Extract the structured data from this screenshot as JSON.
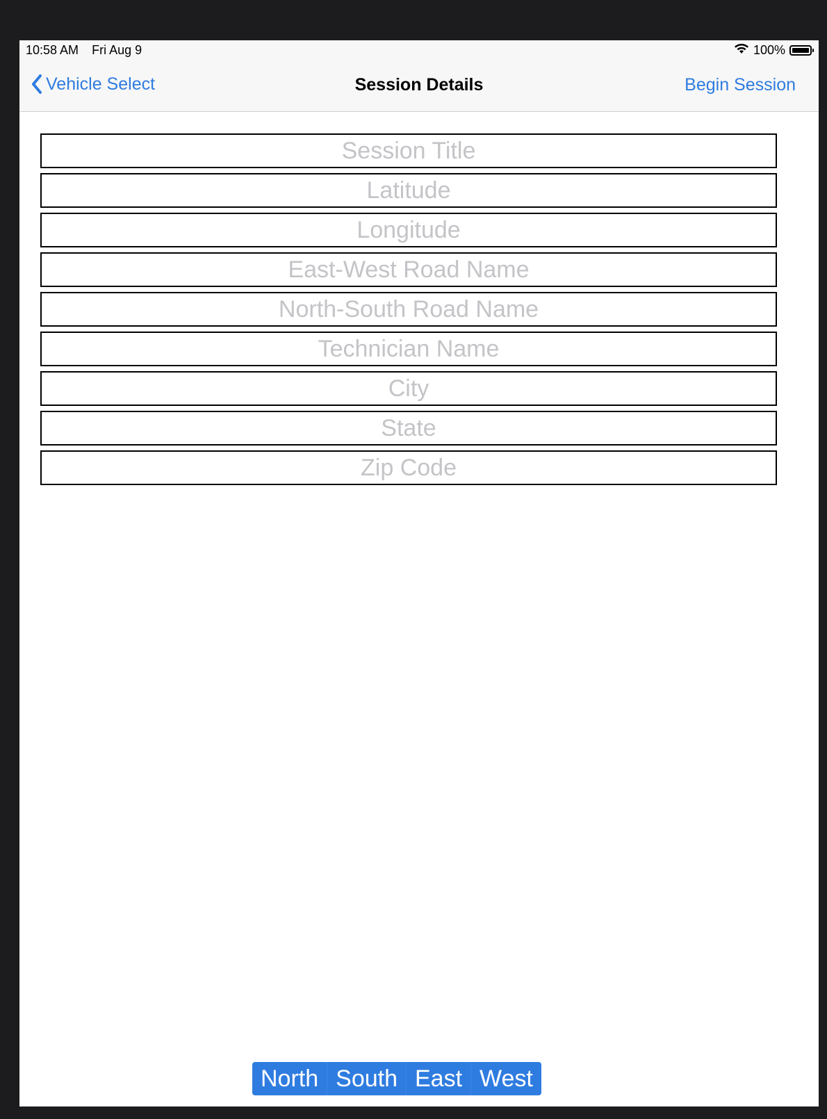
{
  "status_bar": {
    "time": "10:58 AM",
    "date": "Fri Aug 9",
    "battery_percent": "100%",
    "wifi_icon": "wifi-icon",
    "battery_icon": "battery-icon"
  },
  "nav": {
    "back_label": "Vehicle Select",
    "back_icon": "chevron-left-icon",
    "title": "Session Details",
    "action_label": "Begin Session"
  },
  "form": {
    "fields": [
      {
        "placeholder": "Session Title",
        "value": ""
      },
      {
        "placeholder": "Latitude",
        "value": ""
      },
      {
        "placeholder": "Longitude",
        "value": ""
      },
      {
        "placeholder": "East-West Road Name",
        "value": ""
      },
      {
        "placeholder": "North-South Road Name",
        "value": ""
      },
      {
        "placeholder": "Technician Name",
        "value": ""
      },
      {
        "placeholder": "City",
        "value": ""
      },
      {
        "placeholder": "State",
        "value": ""
      },
      {
        "placeholder": "Zip Code",
        "value": ""
      }
    ]
  },
  "direction_control": {
    "segments": [
      "North",
      "South",
      "East",
      "West"
    ],
    "accent_color": "#2f7ce0"
  }
}
